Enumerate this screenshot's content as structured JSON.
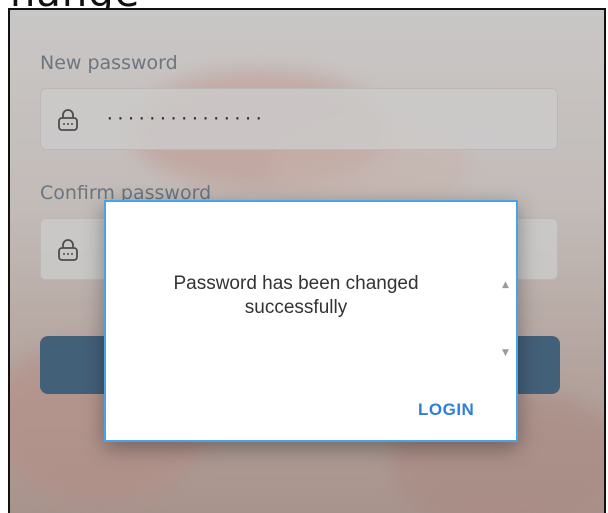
{
  "header": {
    "cropped_title": "hange"
  },
  "form": {
    "new_password_label": "New password",
    "new_password_value": "···············",
    "confirm_password_label": "Confirm password",
    "lock_icon": "lock-icon"
  },
  "dialog": {
    "message_line1": "Password has been changed",
    "message_line2": "successfully",
    "scroll_up_glyph": "▲",
    "scroll_down_glyph": "▼",
    "login_label": "LOGIN"
  },
  "colors": {
    "dialog_border": "#4aa3e8",
    "login_text": "#2f7fd8",
    "submit_button": "#4a6e8e"
  }
}
